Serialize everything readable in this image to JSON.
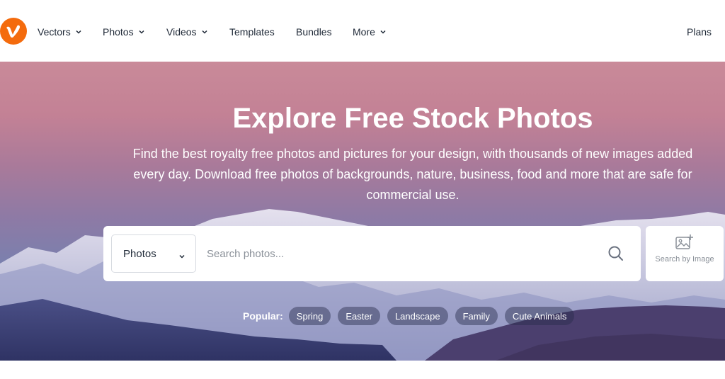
{
  "brand": {
    "name": "vecteezy",
    "color": "#f46b0d"
  },
  "nav": {
    "items": [
      {
        "label": "Vectors",
        "has_dropdown": true
      },
      {
        "label": "Photos",
        "has_dropdown": true
      },
      {
        "label": "Videos",
        "has_dropdown": true
      },
      {
        "label": "Templates",
        "has_dropdown": false
      },
      {
        "label": "Bundles",
        "has_dropdown": false
      },
      {
        "label": "More",
        "has_dropdown": true
      }
    ],
    "plans_label": "Plans"
  },
  "hero": {
    "title": "Explore Free Stock Photos",
    "subtitle": "Find the best royalty free photos and pictures for your design, with thousands of new images added every day. Download free photos of backgrounds, nature, business, food and more that are safe for commercial use."
  },
  "search": {
    "type_selected": "Photos",
    "placeholder": "Search photos...",
    "value": "",
    "search_icon": "search-icon",
    "image_search_label": "Search by Image",
    "image_search_icon": "image-plus-icon"
  },
  "popular": {
    "label": "Popular:",
    "tags": [
      "Spring",
      "Easter",
      "Landscape",
      "Family",
      "Cute Animals"
    ]
  }
}
